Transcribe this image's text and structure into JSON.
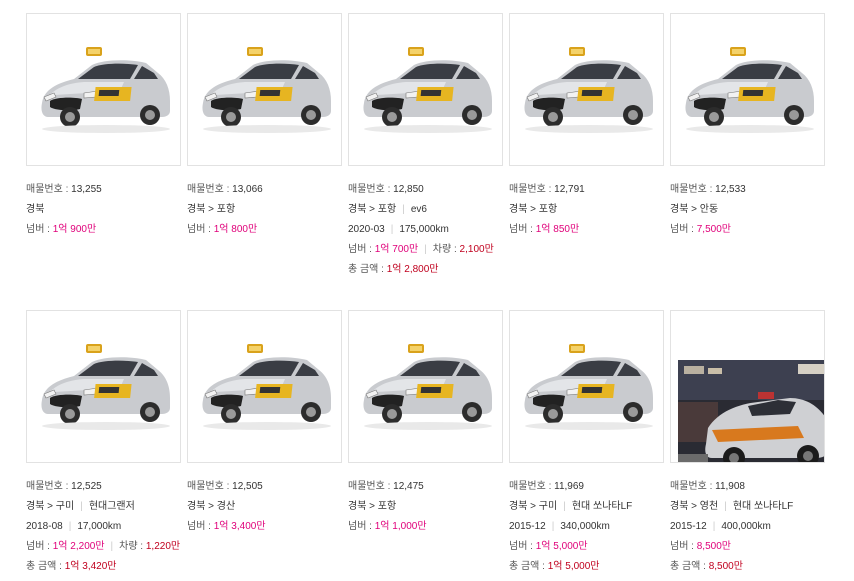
{
  "listings": [
    {
      "no_label": "매물번호 : ",
      "no": "13,255",
      "region": "경북",
      "detail": "",
      "year": "",
      "km": "",
      "num_label": "넘버 : ",
      "num": "1억 900만",
      "car_label": "",
      "car": "",
      "total_label": "",
      "total": "",
      "photo": "taxi"
    },
    {
      "no_label": "매물번호 : ",
      "no": "13,066",
      "region": "경북 > 포항",
      "detail": "",
      "year": "",
      "km": "",
      "num_label": "넘버 : ",
      "num": "1억 800만",
      "car_label": "",
      "car": "",
      "total_label": "",
      "total": "",
      "photo": "taxi"
    },
    {
      "no_label": "매물번호 : ",
      "no": "12,850",
      "region": "경북 > 포항",
      "detail": "ev6",
      "year": "2020-03",
      "km": "175,000km",
      "num_label": "넘버 : ",
      "num": "1억 700만",
      "car_label": "차량 : ",
      "car": "2,100만",
      "total_label": "총 금액 : ",
      "total": "1억 2,800만",
      "photo": "taxi"
    },
    {
      "no_label": "매물번호 : ",
      "no": "12,791",
      "region": "경북 > 포항",
      "detail": "",
      "year": "",
      "km": "",
      "num_label": "넘버 : ",
      "num": "1억 850만",
      "car_label": "",
      "car": "",
      "total_label": "",
      "total": "",
      "photo": "taxi"
    },
    {
      "no_label": "매물번호 : ",
      "no": "12,533",
      "region": "경북 > 안동",
      "detail": "",
      "year": "",
      "km": "",
      "num_label": "넘버 : ",
      "num": "7,500만",
      "car_label": "",
      "car": "",
      "total_label": "",
      "total": "",
      "photo": "taxi"
    },
    {
      "no_label": "매물번호 : ",
      "no": "12,525",
      "region": "경북 > 구미",
      "detail": "현대그랜저",
      "year": "2018-08",
      "km": "17,000km",
      "num_label": "넘버 : ",
      "num": "1억 2,200만",
      "car_label": "차량 : ",
      "car": "1,220만",
      "total_label": "총 금액 : ",
      "total": "1억 3,420만",
      "photo": "taxi"
    },
    {
      "no_label": "매물번호 : ",
      "no": "12,505",
      "region": "경북 > 경산",
      "detail": "",
      "year": "",
      "km": "",
      "num_label": "넘버 : ",
      "num": "1억 3,400만",
      "car_label": "",
      "car": "",
      "total_label": "",
      "total": "",
      "photo": "taxi"
    },
    {
      "no_label": "매물번호 : ",
      "no": "12,475",
      "region": "경북 > 포항",
      "detail": "",
      "year": "",
      "km": "",
      "num_label": "넘버 : ",
      "num": "1억 1,000만",
      "car_label": "",
      "car": "",
      "total_label": "",
      "total": "",
      "photo": "taxi"
    },
    {
      "no_label": "매물번호 : ",
      "no": "11,969",
      "region": "경북 > 구미",
      "detail": "현대 쏘나타LF",
      "year": "2015-12",
      "km": "340,000km",
      "num_label": "넘버 : ",
      "num": "1억 5,000만",
      "car_label": "",
      "car": "",
      "total_label": "총 금액 : ",
      "total": "1억 5,000만",
      "photo": "taxi"
    },
    {
      "no_label": "매물번호 : ",
      "no": "11,908",
      "region": "경북 > 영천",
      "detail": "현대 쏘나타LF",
      "year": "2015-12",
      "km": "400,000km",
      "num_label": "넘버 : ",
      "num": "8,500만",
      "car_label": "",
      "car": "",
      "total_label": "총 금액 : ",
      "total": "8,500만",
      "photo": "night"
    }
  ]
}
